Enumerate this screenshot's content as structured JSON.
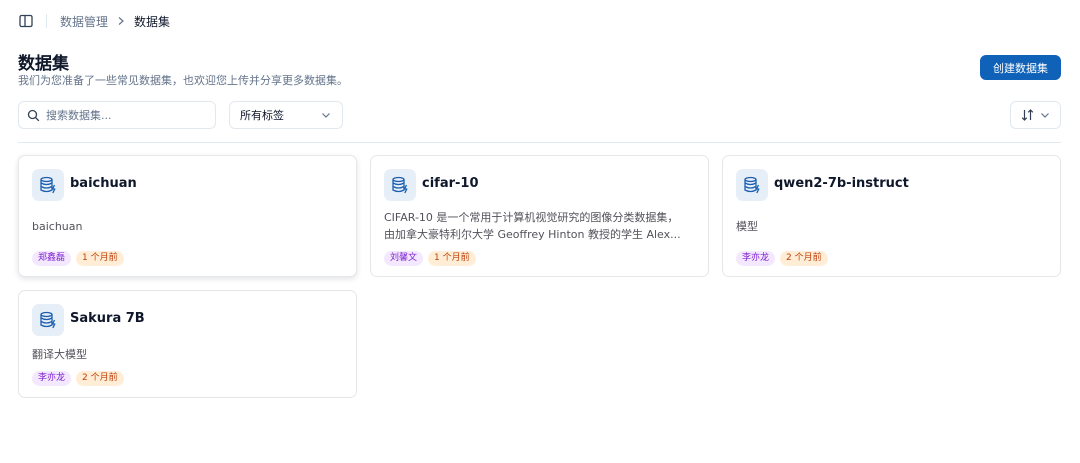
{
  "breadcrumb": {
    "parent": "数据管理",
    "current": "数据集"
  },
  "header": {
    "title": "数据集",
    "subtitle": "我们为您准备了一些常见数据集，也欢迎您上传并分享更多数据集。",
    "create_button": "创建数据集"
  },
  "toolbar": {
    "search_placeholder": "搜索数据集...",
    "tag_filter": "所有标签"
  },
  "datasets": [
    {
      "name": "baichuan",
      "description": "baichuan",
      "author": "郑鑫磊",
      "time": "1 个月前"
    },
    {
      "name": "cifar-10",
      "description_line1": "CIFAR-10 是一个常用于计算机视觉研究的图像分类数据集，",
      "description_line2": "由加拿大豪特利尔大学 Geoffrey Hinton 教授的学生 Alex...",
      "author": "刘馨文",
      "time": "1 个月前"
    },
    {
      "name": "qwen2-7b-instruct",
      "description": "模型",
      "author": "李亦龙",
      "time": "2 个月前"
    },
    {
      "name": "Sakura 7B",
      "description": "翻译大模型",
      "author": "李亦龙",
      "time": "2 个月前"
    }
  ],
  "colors": {
    "accent": "#0f62b8",
    "icon_bg": "#e6eef8",
    "user_tag_bg": "#f3e8ff",
    "user_tag_fg": "#7e22ce",
    "time_tag_bg": "#ffedd5",
    "time_tag_fg": "#c2410c"
  },
  "icons": {
    "dataset": "database-icon",
    "search": "search-icon",
    "dropdown": "chevron-down-icon",
    "sort": "sort-icon",
    "sidebar": "sidebar-toggle-icon",
    "separator": "chevron-right-icon"
  }
}
